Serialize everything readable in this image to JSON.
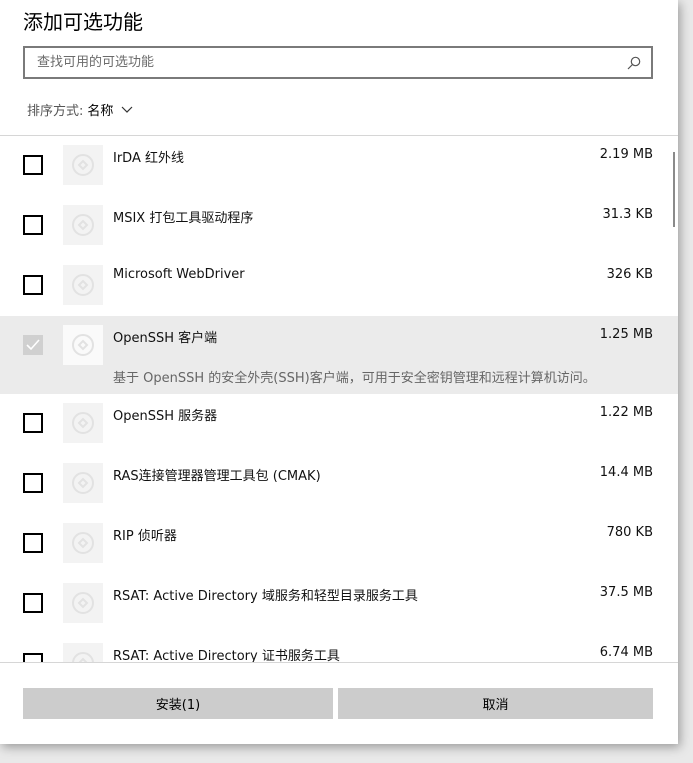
{
  "dialog": {
    "title": "添加可选功能"
  },
  "search": {
    "placeholder": "查找可用的可选功能",
    "icon": "search-icon"
  },
  "sort": {
    "label": "排序方式:",
    "value": "名称",
    "icon": "chevron-down-icon"
  },
  "features": [
    {
      "name": "IrDA 红外线",
      "size": "2.19 MB",
      "checked": false
    },
    {
      "name": "MSIX 打包工具驱动程序",
      "size": "31.3 KB",
      "checked": false
    },
    {
      "name": "Microsoft WebDriver",
      "size": "326 KB",
      "checked": false
    },
    {
      "name": "OpenSSH 客户端",
      "size": "1.25 MB",
      "checked": true,
      "description": "基于 OpenSSH 的安全外壳(SSH)客户端，可用于安全密钥管理和远程计算机访问。"
    },
    {
      "name": "OpenSSH 服务器",
      "size": "1.22 MB",
      "checked": false
    },
    {
      "name": "RAS连接管理器管理工具包 (CMAK)",
      "size": "14.4 MB",
      "checked": false
    },
    {
      "name": "RIP 侦听器",
      "size": "780 KB",
      "checked": false
    },
    {
      "name": "RSAT: Active Directory 域服务和轻型目录服务工具",
      "size": "37.5 MB",
      "checked": false
    },
    {
      "name": "RSAT: Active Directory 证书服务工具",
      "size": "6.74 MB",
      "checked": false
    }
  ],
  "footer": {
    "install_label": "安装(1)",
    "cancel_label": "取消"
  }
}
